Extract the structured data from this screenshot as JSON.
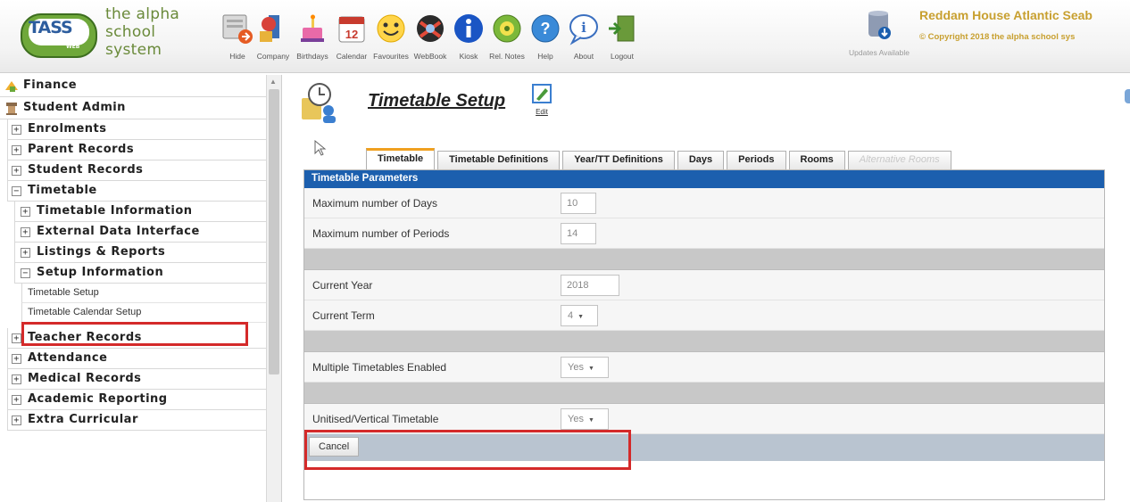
{
  "app": {
    "logo_badge": "TASS",
    "logo_badge_sub": "WEB",
    "logo_lines": [
      "the alpha",
      "school",
      "system"
    ]
  },
  "toolbar": {
    "items": [
      {
        "label": "Hide",
        "icon": "hide-icon"
      },
      {
        "label": "Company",
        "icon": "company-icon"
      },
      {
        "label": "Birthdays",
        "icon": "birthday-cake-icon"
      },
      {
        "label": "Calendar",
        "icon": "calendar-icon"
      },
      {
        "label": "Favourites",
        "icon": "smiley-icon"
      },
      {
        "label": "WebBook",
        "icon": "webbook-icon"
      },
      {
        "label": "Kiosk",
        "icon": "info-icon"
      },
      {
        "label": "Rel. Notes",
        "icon": "release-notes-icon"
      },
      {
        "label": "Help",
        "icon": "help-icon"
      },
      {
        "label": "About",
        "icon": "about-icon"
      },
      {
        "label": "Logout",
        "icon": "logout-icon"
      }
    ],
    "updates_label": "Updates Available",
    "calendar_day": "12",
    "school_name": "Reddam House Atlantic Seab",
    "copyright": "© Copyright 2018 the alpha school sys"
  },
  "sidebar": {
    "top": [
      {
        "label": "Finance",
        "icon": "finance-icon"
      },
      {
        "label": "Student Admin",
        "icon": "student-admin-icon"
      }
    ],
    "items": [
      {
        "label": "Enrolments",
        "state": "+"
      },
      {
        "label": "Parent Records",
        "state": "+"
      },
      {
        "label": "Student Records",
        "state": "+"
      },
      {
        "label": "Timetable",
        "state": "−"
      }
    ],
    "timetable_sub": [
      {
        "label": "Timetable Information",
        "state": "+"
      },
      {
        "label": "External Data Interface",
        "state": "+"
      },
      {
        "label": "Listings & Reports",
        "state": "+"
      },
      {
        "label": "Setup Information",
        "state": "−"
      }
    ],
    "leaves": [
      "Timetable Setup",
      "Timetable Calendar Setup"
    ],
    "after": [
      {
        "label": "Teacher Records",
        "state": "+"
      },
      {
        "label": "Attendance",
        "state": "+"
      },
      {
        "label": "Medical Records",
        "state": "+"
      },
      {
        "label": "Academic Reporting",
        "state": "+"
      },
      {
        "label": "Extra Curricular",
        "state": "+"
      }
    ]
  },
  "main": {
    "title": "Timetable Setup",
    "edit_label": "Edit",
    "tabs": [
      {
        "label": "Timetable",
        "active": true
      },
      {
        "label": "Timetable Definitions"
      },
      {
        "label": "Year/TT Definitions"
      },
      {
        "label": "Days"
      },
      {
        "label": "Periods"
      },
      {
        "label": "Rooms"
      },
      {
        "label": "Alternative Rooms",
        "disabled": true
      }
    ],
    "panel_title": "Timetable Parameters",
    "fields": {
      "max_days_label": "Maximum number of Days",
      "max_days_value": "10",
      "max_periods_label": "Maximum number of Periods",
      "max_periods_value": "14",
      "current_year_label": "Current Year",
      "current_year_value": "2018",
      "current_term_label": "Current Term",
      "current_term_value": "4",
      "multi_tt_label": "Multiple Timetables Enabled",
      "multi_tt_value": "Yes",
      "unitised_label": "Unitised/Vertical Timetable",
      "unitised_value": "Yes"
    },
    "cancel_label": "Cancel"
  },
  "colors": {
    "panel_header": "#1c5fae",
    "active_tab_accent": "#f0a020",
    "highlight_box": "#d42a2a",
    "brand_gold": "#c8a030"
  }
}
